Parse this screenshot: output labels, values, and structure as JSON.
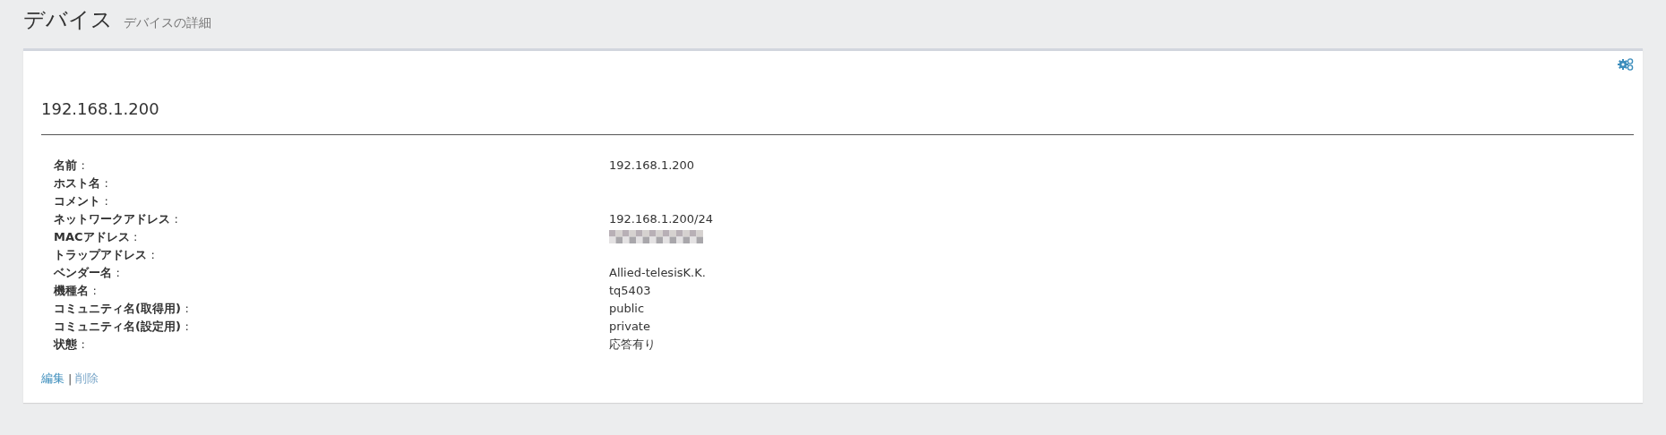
{
  "header": {
    "title": "デバイス",
    "subtitle": "デバイスの詳細"
  },
  "card": {
    "heading": "192.168.1.200",
    "fields": [
      {
        "label": "名前",
        "separator": ":",
        "value": "192.168.1.200"
      },
      {
        "label": "ホスト名",
        "separator": ":"
      },
      {
        "label": "コメント",
        "separator": ":"
      },
      {
        "label": "ネットワークアドレス",
        "separator": ":",
        "value": "192.168.1.200/24"
      },
      {
        "label": "MACアドレス",
        "separator": ":",
        "redacted": true
      },
      {
        "label": "トラップアドレス",
        "separator": ":"
      },
      {
        "label": "ベンダー名",
        "separator": ":",
        "value": "Allied-telesisK.K."
      },
      {
        "label": "機種名",
        "separator": ":",
        "value": "tq5403"
      },
      {
        "label": "コミュニティ名(取得用)",
        "separator": ":",
        "value": "public"
      },
      {
        "label": "コミュニティ名(設定用)",
        "separator": ":",
        "value": "private"
      },
      {
        "label": "状態",
        "separator": ":",
        "value": "応答有り"
      }
    ],
    "links": [
      {
        "label": "編集",
        "disabled": false
      },
      {
        "label": "削除",
        "disabled": true
      }
    ],
    "link_separator": "|"
  }
}
